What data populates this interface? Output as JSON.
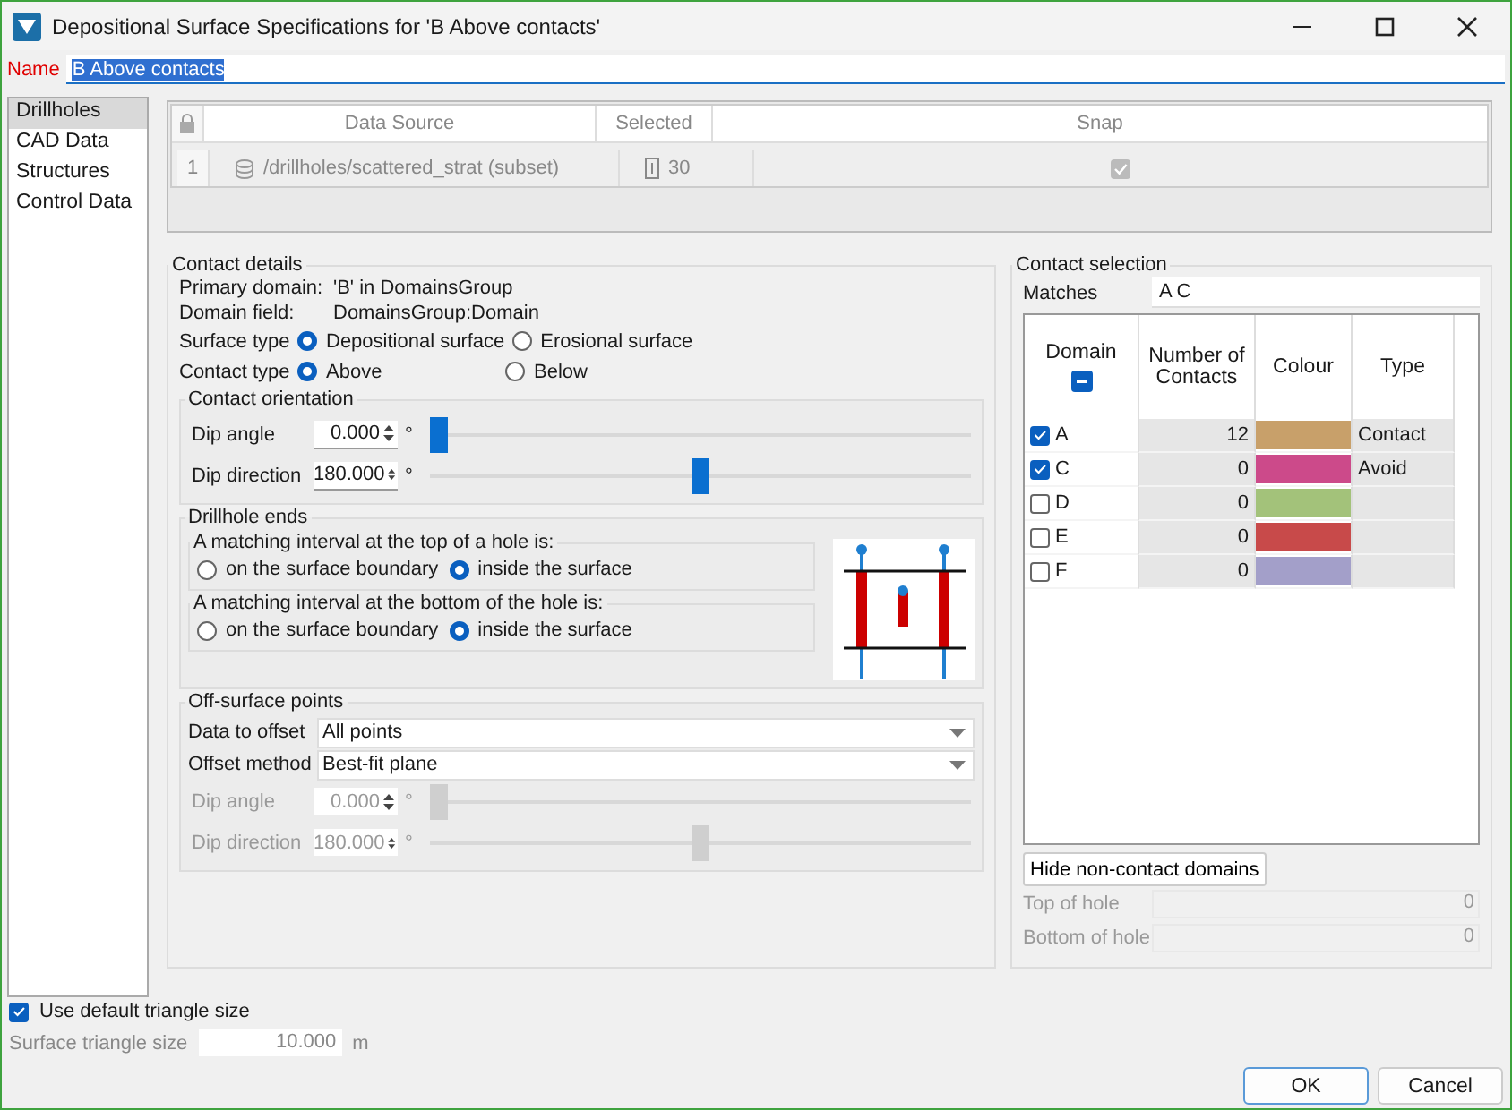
{
  "window": {
    "title": "Depositional Surface Specifications for 'B Above contacts'"
  },
  "name_field": {
    "label": "Name",
    "value": "B Above contacts"
  },
  "sidebar": {
    "items": [
      {
        "label": "Drillholes",
        "selected": true
      },
      {
        "label": "CAD Data",
        "selected": false
      },
      {
        "label": "Structures",
        "selected": false
      },
      {
        "label": "Control Data",
        "selected": false
      }
    ]
  },
  "data_source_table": {
    "columns": [
      "Data Source",
      "Selected",
      "Snap"
    ],
    "rows": [
      {
        "index": "1",
        "source": "/drillholes/scattered_strat (subset)",
        "selected_count": "30",
        "snap": true
      }
    ]
  },
  "contact_details": {
    "title": "Contact details",
    "info": [
      {
        "label": "Primary domain:",
        "value": "'B' in DomainsGroup"
      },
      {
        "label": "Domain field:",
        "value": "DomainsGroup:Domain"
      }
    ],
    "radio_rows": [
      {
        "label": "Surface type",
        "options": [
          {
            "label": "Depositional surface",
            "selected": true
          },
          {
            "label": "Erosional surface",
            "selected": false
          }
        ]
      },
      {
        "label": "Contact type",
        "options": [
          {
            "label": "Above",
            "selected": true
          },
          {
            "label": "Below",
            "selected": false
          }
        ]
      }
    ],
    "orientation": {
      "title": "Contact orientation",
      "sliders": [
        {
          "label": "Dip angle",
          "value": "0.000",
          "unit": "°",
          "level": 0
        },
        {
          "label": "Dip direction",
          "value": "180.000",
          "unit": "°",
          "level": 0.5
        }
      ]
    }
  },
  "drillhole_ends": {
    "title": "Drillhole ends",
    "groups": [
      {
        "title": "A matching interval at the top of a hole is:",
        "options": [
          {
            "label": "on the surface boundary",
            "selected": false
          },
          {
            "label": "inside the surface",
            "selected": true
          }
        ]
      },
      {
        "title": "A matching interval at the bottom of the hole is:",
        "options": [
          {
            "label": "on the surface boundary",
            "selected": false
          },
          {
            "label": "inside the surface",
            "selected": true
          }
        ]
      }
    ]
  },
  "off_surface": {
    "title": "Off-surface points",
    "dropdowns": [
      {
        "label": "Data to offset",
        "value": "All points"
      },
      {
        "label": "Offset method",
        "value": "Best-fit plane"
      }
    ],
    "sliders": [
      {
        "label": "Dip angle",
        "value": "0.000",
        "unit": "°",
        "level": 0,
        "disabled": true
      },
      {
        "label": "Dip direction",
        "value": "180.000",
        "unit": "°",
        "level": 0.5,
        "disabled": true
      }
    ]
  },
  "contact_selection": {
    "title": "Contact selection",
    "matches_label": "Matches",
    "matches_value": "A C",
    "columns": [
      "Domain",
      "Number of Contacts",
      "Colour",
      "Type"
    ],
    "rows": [
      {
        "domain": "A",
        "checked": true,
        "count": "12",
        "color": "#c8a06a",
        "type": "Contact"
      },
      {
        "domain": "C",
        "checked": true,
        "count": "0",
        "color": "#cc4a8a",
        "type": "Avoid"
      },
      {
        "domain": "D",
        "checked": false,
        "count": "0",
        "color": "#a3c27a"
      },
      {
        "domain": "E",
        "checked": false,
        "count": "0",
        "color": "#c84a4a"
      },
      {
        "domain": "F",
        "checked": false,
        "count": "0",
        "color": "#a39fc9"
      }
    ],
    "hide_button": "Hide non-contact domains",
    "stats": [
      {
        "label": "Top of hole",
        "value": "0"
      },
      {
        "label": "Bottom of hole",
        "value": "0"
      }
    ]
  },
  "triangle": {
    "use_default": {
      "label": "Use default triangle size",
      "checked": true
    },
    "size": {
      "label": "Surface triangle size",
      "value": "10.000",
      "unit": "m"
    }
  },
  "buttons": [
    {
      "label": "OK",
      "kind": "primary"
    },
    {
      "label": "Cancel",
      "kind": "secondary"
    }
  ]
}
